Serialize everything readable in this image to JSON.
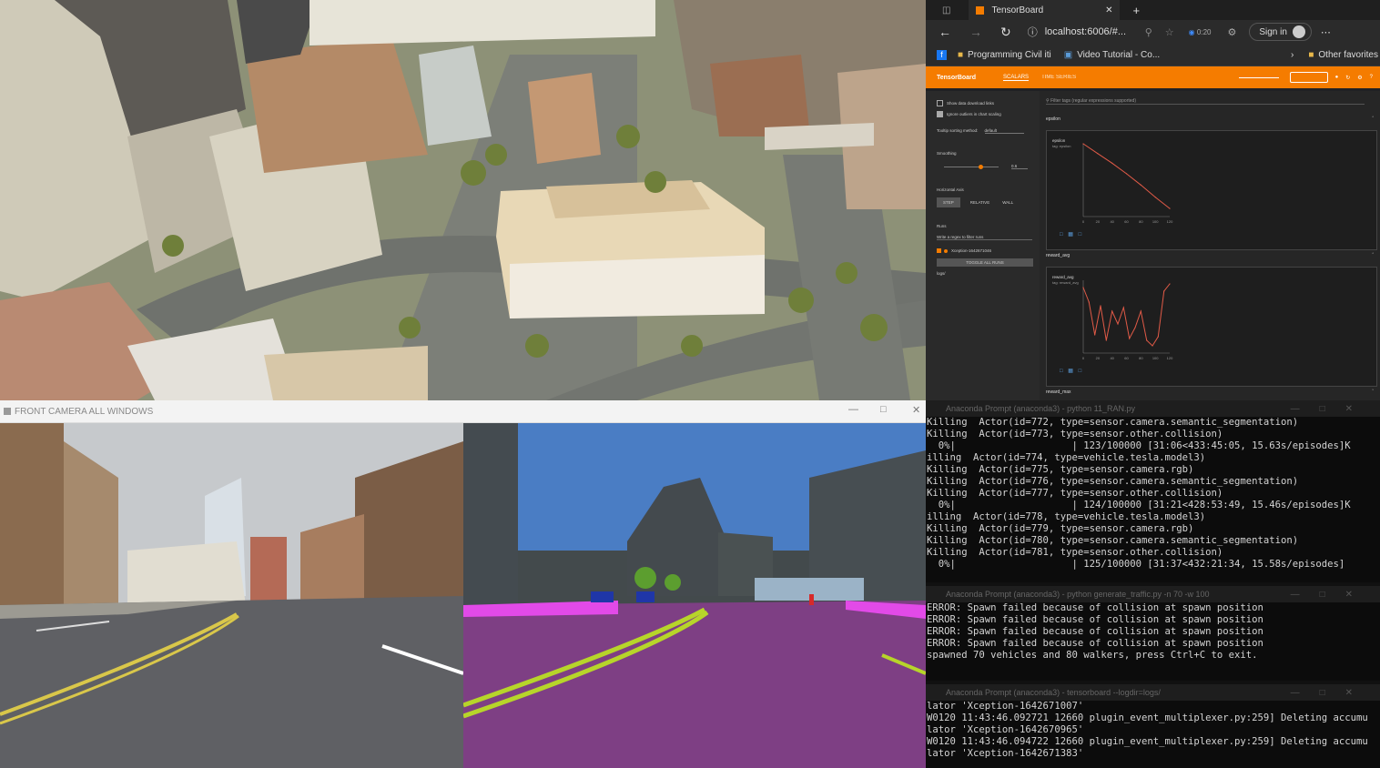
{
  "browser": {
    "tab_title": "TensorBoard",
    "url": "localhost:6006/#...",
    "timer": "0:20",
    "sign_in": "Sign in",
    "bookmarks": [
      "Programming Civil iti",
      "Video Tutorial - Co..."
    ],
    "other_favorites": "Other favorites",
    "tensorboard": {
      "brand": "TensorBoard",
      "tabs": [
        "SCALARS",
        "TIME SERIES"
      ],
      "active_tab": "SCALARS",
      "filter_placeholder": "Filter tags (regular expressions supported)",
      "sidebar": {
        "checkbox1": "Show data download links",
        "checkbox2": "Ignore outliers in chart scaling",
        "tooltip_label": "Tooltip sorting method:",
        "tooltip_value": "default",
        "smoothing_label": "Smoothing",
        "smoothing_value": "0.6",
        "horizontal_axis_label": "Horizontal Axis",
        "axis_buttons": [
          "STEP",
          "RELATIVE",
          "WALL"
        ],
        "runs_label": "Runs",
        "runs_filter": "Write a regex to filter runs",
        "run_name": "Xception-1642671046",
        "toggle_all": "TOGGLE ALL RUNS",
        "logs": "logs/"
      },
      "cards": [
        {
          "section": "epsilon",
          "title": "epsilon",
          "tag": "tag: epsilon"
        },
        {
          "section": "reward_avg",
          "title": "reward_avg",
          "tag": "tag: reward_avg"
        },
        {
          "section": "reward_max"
        }
      ]
    }
  },
  "camera_window": {
    "title": "FRONT CAMERA ALL WINDOWS"
  },
  "terminal1": {
    "title": "Anaconda Prompt (anaconda3) - python  11_RAN.py",
    "lines": [
      "Killing  Actor(id=772, type=sensor.camera.semantic_segmentation)",
      "Killing  Actor(id=773, type=sensor.other.collision)",
      "  0%|                    | 123/100000 [31:06<433:45:05, 15.63s/episodes]K",
      "illing  Actor(id=774, type=vehicle.tesla.model3)",
      "Killing  Actor(id=775, type=sensor.camera.rgb)",
      "Killing  Actor(id=776, type=sensor.camera.semantic_segmentation)",
      "Killing  Actor(id=777, type=sensor.other.collision)",
      "  0%|                    | 124/100000 [31:21<428:53:49, 15.46s/episodes]K",
      "illing  Actor(id=778, type=vehicle.tesla.model3)",
      "Killing  Actor(id=779, type=sensor.camera.rgb)",
      "Killing  Actor(id=780, type=sensor.camera.semantic_segmentation)",
      "Killing  Actor(id=781, type=sensor.other.collision)",
      "  0%|                    | 125/100000 [31:37<432:21:34, 15.58s/episodes]"
    ]
  },
  "terminal2": {
    "title": "Anaconda Prompt (anaconda3) - python  generate_traffic.py  -n 70  -w 100",
    "lines": [
      "ERROR: Spawn failed because of collision at spawn position",
      "ERROR: Spawn failed because of collision at spawn position",
      "ERROR: Spawn failed because of collision at spawn position",
      "ERROR: Spawn failed because of collision at spawn position",
      "spawned 70 vehicles and 80 walkers, press Ctrl+C to exit."
    ]
  },
  "terminal3": {
    "title": "Anaconda Prompt (anaconda3) - tensorboard  --logdir=logs/",
    "lines": [
      "lator 'Xception-1642671007'",
      "W0120 11:43:46.092721 12660 plugin_event_multiplexer.py:259] Deleting accumu",
      "lator 'Xception-1642670965'",
      "W0120 11:43:46.094722 12660 plugin_event_multiplexer.py:259] Deleting accumu",
      "lator 'Xception-1642671383'"
    ]
  },
  "chart_data": [
    {
      "type": "line",
      "title": "epsilon",
      "x": [
        0,
        20,
        40,
        60,
        80,
        100,
        120
      ],
      "y": [
        1.0,
        0.88,
        0.76,
        0.63,
        0.49,
        0.34,
        0.2
      ],
      "ylim": [
        0.1,
        1.0
      ],
      "xlim": [
        0,
        120
      ]
    },
    {
      "type": "line",
      "title": "reward_avg",
      "x": [
        0,
        8,
        16,
        24,
        32,
        40,
        48,
        56,
        64,
        72,
        80,
        88,
        96,
        104,
        112,
        120
      ],
      "y": [
        -40,
        -120,
        -300,
        -140,
        -330,
        -170,
        -240,
        -150,
        -320,
        -260,
        -170,
        -330,
        -360,
        -310,
        -60,
        -20
      ],
      "ylim": [
        -400,
        0
      ],
      "xlim": [
        0,
        120
      ]
    }
  ]
}
